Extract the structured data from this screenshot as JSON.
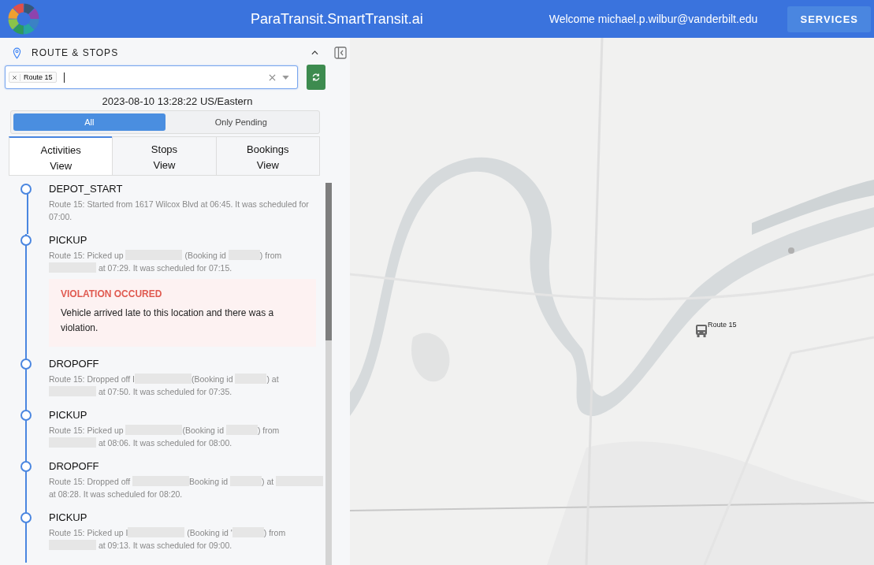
{
  "header": {
    "title": "ParaTransit.SmartTransit.ai",
    "welcome": "Welcome michael.p.wilbur@vanderbilt.edu",
    "services_button": "SERVICES"
  },
  "panel": {
    "title": "ROUTE & STOPS",
    "expanded": true,
    "route_select": {
      "chips": [
        "Route 15"
      ]
    },
    "timestamp": "2023-08-10 13:28:22 US/Eastern",
    "filters": [
      {
        "label": "All",
        "selected": true
      },
      {
        "label": "Only Pending",
        "selected": false
      }
    ],
    "tabs": [
      {
        "label": "Activities View",
        "selected": true
      },
      {
        "label": "Stops View",
        "selected": false
      },
      {
        "label": "Bookings View",
        "selected": false
      }
    ],
    "activities": [
      {
        "title": "DEPOT_START",
        "parts": [
          {
            "kind": "text",
            "text": "Route 15: Started from 1617 Wilcox Blvd at 06:45. It was scheduled for 07:00."
          }
        ]
      },
      {
        "title": "PICKUP",
        "parts": [
          {
            "kind": "text",
            "text": "Route 15: Picked up "
          },
          {
            "kind": "name"
          },
          {
            "kind": "text",
            "text": " (Booking id "
          },
          {
            "kind": "id"
          },
          {
            "kind": "text",
            "text": ") from "
          },
          {
            "kind": "place"
          },
          {
            "kind": "text",
            "text": " at 07:29. It was scheduled for 07:15."
          }
        ],
        "violation": {
          "title": "VIOLATION OCCURED",
          "text": "Vehicle arrived late to this location and there was a violation."
        }
      },
      {
        "title": "DROPOFF",
        "parts": [
          {
            "kind": "text",
            "text": "Route 15: Dropped off I"
          },
          {
            "kind": "name"
          },
          {
            "kind": "text",
            "text": "(Booking id "
          },
          {
            "kind": "id"
          },
          {
            "kind": "text",
            "text": ") at "
          },
          {
            "kind": "place"
          },
          {
            "kind": "text",
            "text": " at 07:50. It was scheduled for 07:35."
          }
        ]
      },
      {
        "title": "PICKUP",
        "parts": [
          {
            "kind": "text",
            "text": "Route 15: Picked up "
          },
          {
            "kind": "name"
          },
          {
            "kind": "text",
            "text": "(Booking id "
          },
          {
            "kind": "id"
          },
          {
            "kind": "text",
            "text": ") from "
          },
          {
            "kind": "place"
          },
          {
            "kind": "text",
            "text": " at 08:06. It was scheduled for 08:00."
          }
        ]
      },
      {
        "title": "DROPOFF",
        "parts": [
          {
            "kind": "text",
            "text": "Route 15: Dropped off "
          },
          {
            "kind": "name"
          },
          {
            "kind": "text",
            "text": "Booking id "
          },
          {
            "kind": "id"
          },
          {
            "kind": "text",
            "text": ") at "
          },
          {
            "kind": "place"
          },
          {
            "kind": "text",
            "text": " at 08:28. It was scheduled for 08:20."
          }
        ]
      },
      {
        "title": "PICKUP",
        "parts": [
          {
            "kind": "text",
            "text": "Route 15: Picked up I"
          },
          {
            "kind": "name"
          },
          {
            "kind": "text",
            "text": " (Booking id '"
          },
          {
            "kind": "id"
          },
          {
            "kind": "text",
            "text": ") from "
          },
          {
            "kind": "place"
          },
          {
            "kind": "text",
            "text": " at 09:13. It was scheduled for 09:00."
          }
        ]
      }
    ]
  },
  "map": {
    "vehicles": [
      {
        "label": "Route 15"
      }
    ]
  }
}
